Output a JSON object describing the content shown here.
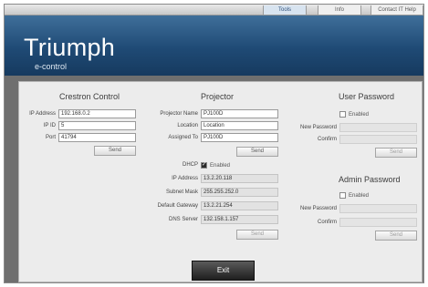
{
  "nav": {
    "tools": "Tools",
    "info": "Info",
    "contact": "Contact IT Help"
  },
  "brand": {
    "title": "Triumph",
    "subtitle": "e-control"
  },
  "crestron": {
    "title": "Crestron Control",
    "ip_label": "IP Address",
    "ip_value": "192.168.0.2",
    "ipid_label": "IP ID",
    "ipid_value": "5",
    "port_label": "Port",
    "port_value": "41794",
    "send": "Send"
  },
  "projector": {
    "title": "Projector",
    "name_label": "Projector Name",
    "name_value": "PJ100D",
    "location_label": "Location",
    "location_value": "Location",
    "assigned_label": "Assigned To",
    "assigned_value": "PJ100D",
    "send": "Send",
    "dhcp_label": "DHCP",
    "dhcp_enabled_label": "Enabled",
    "dhcp_enabled": true,
    "ip_label": "IP Address",
    "ip_value": "13.2.20.118",
    "subnet_label": "Subnet Mask",
    "subnet_value": "255.255.252.0",
    "gateway_label": "Default Gateway",
    "gateway_value": "13.2.21.254",
    "dns_label": "DNS Server",
    "dns_value": "132.158.1.157",
    "send2": "Send"
  },
  "user_password": {
    "title": "User Password",
    "enabled_label": "Enabled",
    "new_label": "New Password",
    "confirm_label": "Confirm",
    "send": "Send"
  },
  "admin_password": {
    "title": "Admin Password",
    "enabled_label": "Enabled",
    "new_label": "New Password",
    "confirm_label": "Confirm",
    "send": "Send"
  },
  "exit": "Exit"
}
